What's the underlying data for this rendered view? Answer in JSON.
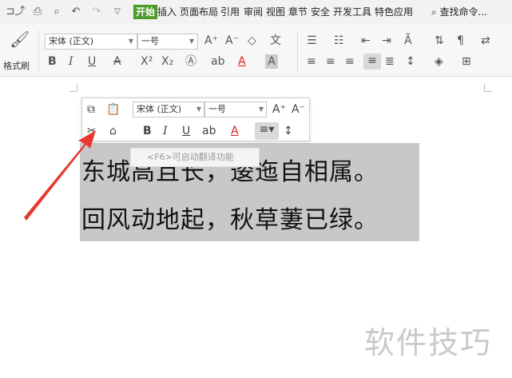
{
  "ribbon": {
    "tabs": [
      "开始",
      "插入",
      "页面布局",
      "引用",
      "审阅",
      "视图",
      "章节",
      "安全",
      "开发工具",
      "特色应用"
    ],
    "active_tab": "开始",
    "search_label": "查找命令...",
    "format_brush_label": "格式刷",
    "font_name": "宋体 (正文)",
    "font_size": "一号",
    "quick_access_icons": [
      "save-icon",
      "print-icon",
      "preview-icon",
      "undo-icon",
      "redo-icon",
      "more-icon"
    ],
    "colors": {
      "active_tab_bg": "#4c9a2a",
      "font_color_bar": "#e02020"
    }
  },
  "mini_toolbar": {
    "font_name": "宋体 (正文)",
    "font_size": "一号",
    "hint": "<F6>可启动翻译功能"
  },
  "document": {
    "lines": [
      "东城高且长，逶迤自相属。",
      "回风动地起，秋草萋已绿。"
    ]
  },
  "watermark": "软件技巧",
  "arrow_color": "#e8392f"
}
